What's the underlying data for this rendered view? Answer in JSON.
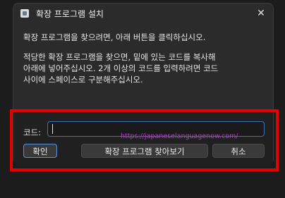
{
  "window": {
    "title": "확장 프로그램 설치",
    "close_glyph": "✕"
  },
  "content": {
    "instruction": "확장 프로그램을 찾으려면, 아래 버튼을 클릭하십시오.",
    "detail_line1": "적당한 확장 프로그램을 찾으면, 밑에 있는 코드를 복사해",
    "detail_line2": "아래에 넣어주십시오. 2개 이상의 코드를 입력하려면 코드",
    "detail_line3": "사이에 스페이스로 구분해주십시오."
  },
  "footer": {
    "code_label": "코드:",
    "code_value": "",
    "watermark": "https://japaneselanguagenow.com/",
    "ok_label": "확인",
    "browse_label": "확장 프로그램 찾아보기",
    "cancel_label": "취소"
  },
  "colors": {
    "dialog_bg": "#2b2b2b",
    "accent_border": "#3e6fb8",
    "highlight": "#e60000",
    "watermark": "#b03ad6"
  }
}
